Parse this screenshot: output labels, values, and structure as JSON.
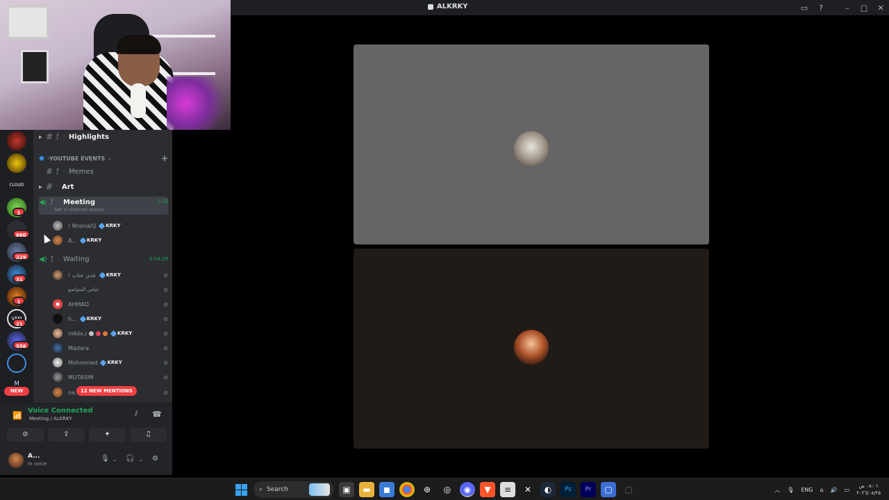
{
  "window": {
    "title": "ALKRKY"
  },
  "titlebar_controls": [
    "inbox-icon",
    "help-icon",
    "minimize-icon",
    "maximize-icon",
    "close-icon"
  ],
  "servers": [
    {
      "badge": ""
    },
    {
      "badge": ""
    },
    {
      "badge": ""
    },
    {
      "badge": "1"
    },
    {
      "badge": "660"
    },
    {
      "badge": "229"
    },
    {
      "badge": "31"
    },
    {
      "badge": "1"
    },
    {
      "badge": "21"
    },
    {
      "badge": "556"
    },
    {
      "badge": ""
    },
    {
      "badge": ""
    }
  ],
  "server_new_label": "NEW",
  "channels": {
    "highlights": "Highlights",
    "category": "YOUTUBE EVENTS",
    "memes": "Memes",
    "art": "Art",
    "meeting": {
      "name": "Meeting",
      "timer": "1:15",
      "status": "Set a channel status"
    },
    "meeting_users": [
      {
        "name": "! NnonaiQ",
        "tag": "KRKY"
      },
      {
        "name": "A...",
        "tag": "KRKY"
      }
    ],
    "waiting": {
      "name": "Waiting",
      "timer": "2:54:29"
    },
    "waiting_users": [
      {
        "name": "! عدي عتاب",
        "tag": "KRKY"
      },
      {
        "name": "عباس المتواضع",
        "tag": ""
      },
      {
        "name": "AHMAD",
        "tag": ""
      },
      {
        "name": "h...",
        "tag": "KRKY"
      },
      {
        "name": "m6öx.j",
        "tag": "KRKY"
      },
      {
        "name": "Madara",
        "tag": ""
      },
      {
        "name": "Mohmmed",
        "tag": "KRKY"
      },
      {
        "name": "MUTASIM",
        "tag": ""
      },
      {
        "name": "na...",
        "tag": ""
      }
    ],
    "mentions_pill": "12 NEW MENTIONS"
  },
  "voice_panel": {
    "status": "Voice Connected",
    "location": "Meeting / ALKRKY"
  },
  "user_panel": {
    "name": "A...",
    "status": "In voice"
  },
  "taskbar": {
    "search_label": "Search",
    "language": "ENG",
    "clock_time": "٠٨:٠١ ص",
    "clock_date": "٢٠٢٦/٠٨/٢٥"
  },
  "colors": {
    "voice_green": "#23a55a",
    "badge_red": "#f23f43",
    "tile_1_bg": "#666467",
    "tile_2_bg": "#211b18"
  }
}
